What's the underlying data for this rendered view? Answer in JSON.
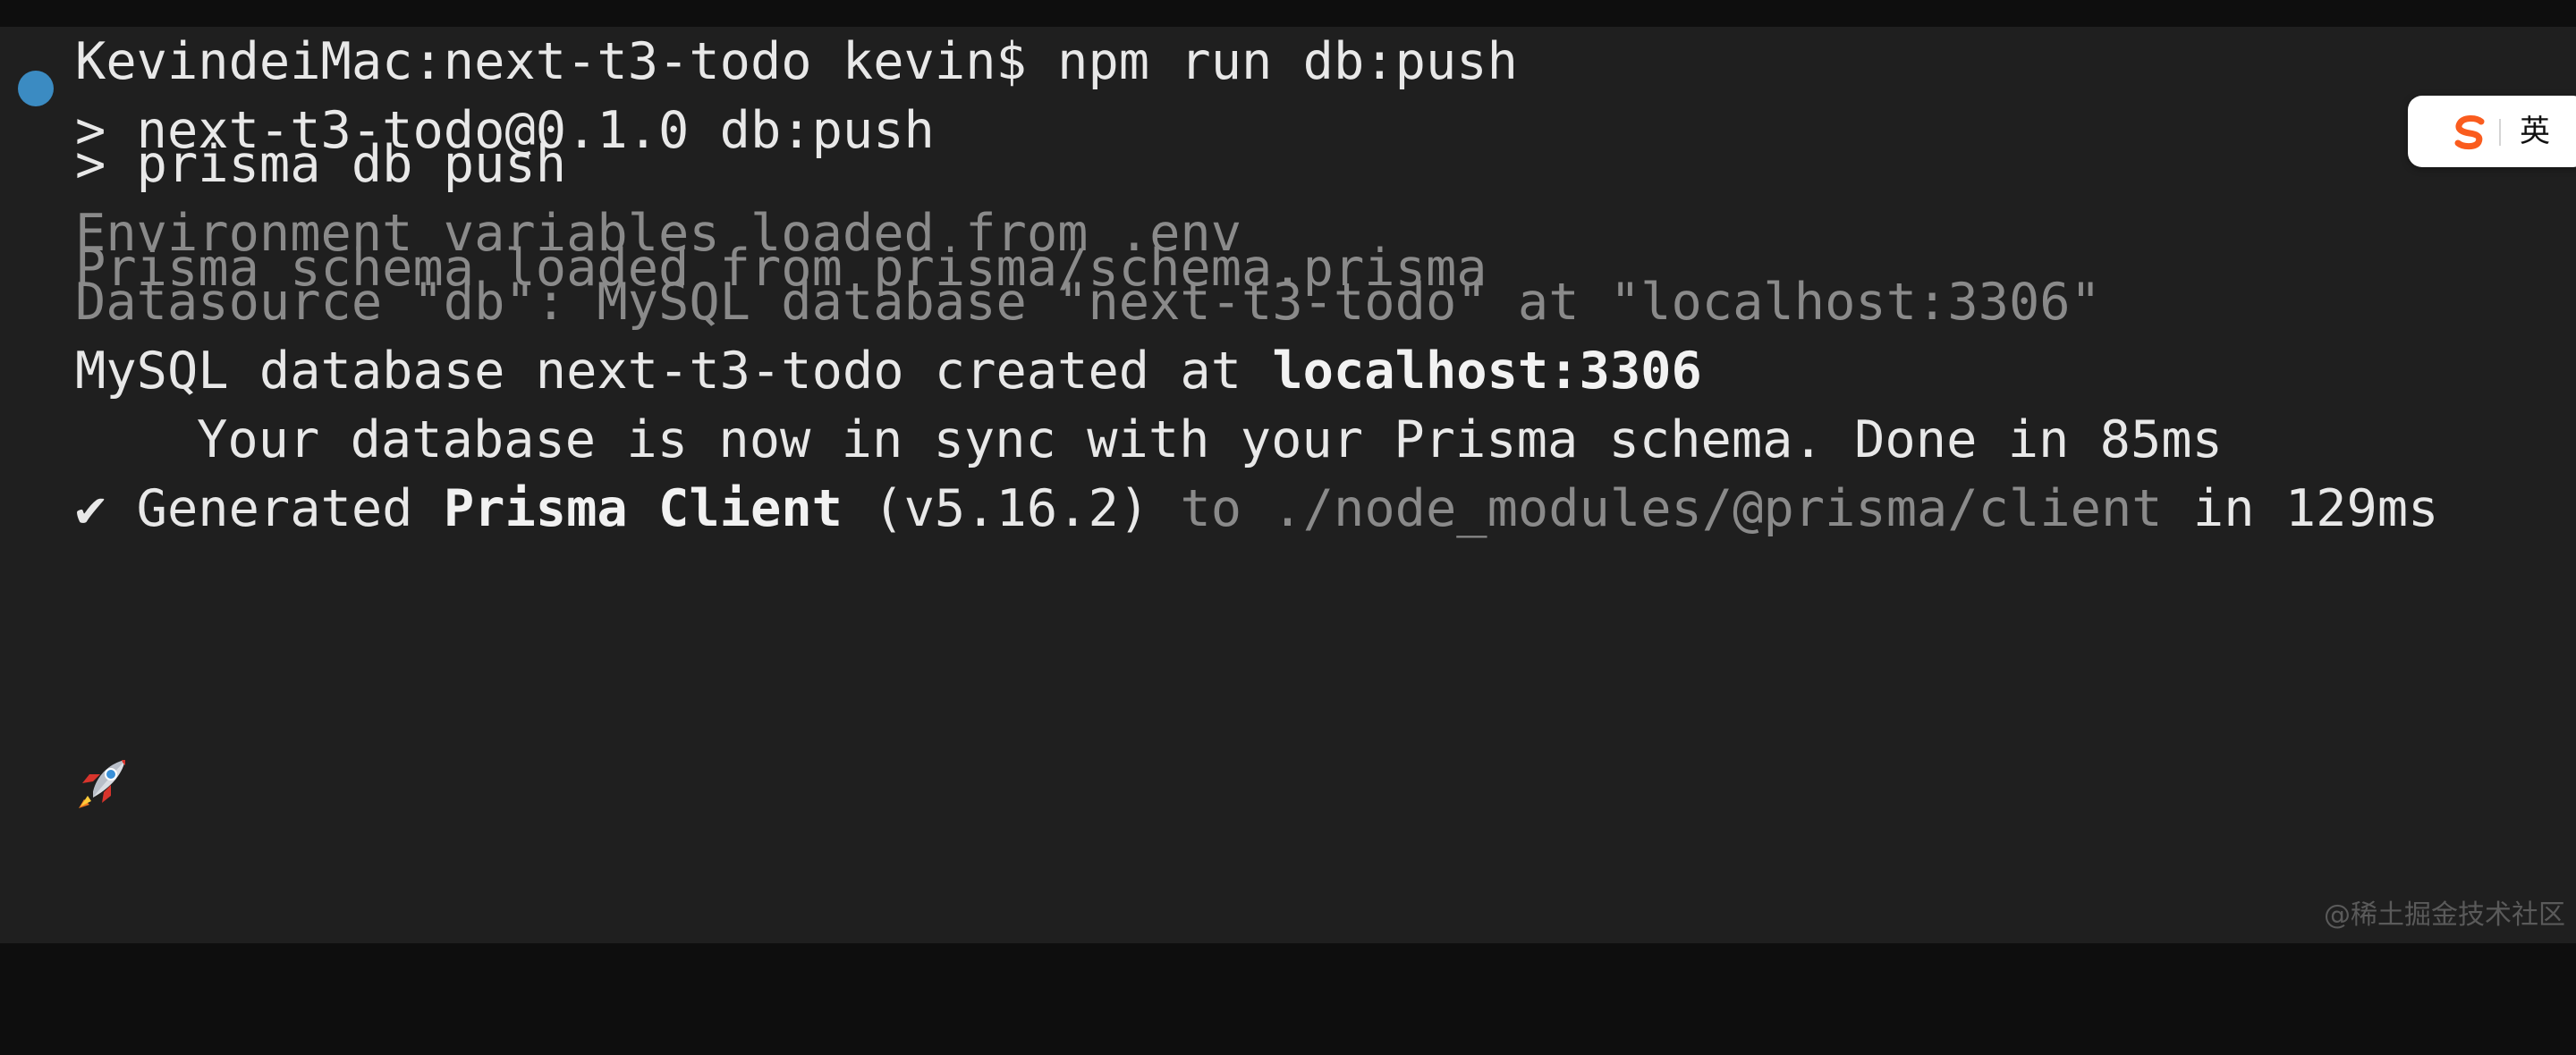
{
  "terminal": {
    "prompt": {
      "text": "KevindeiMac:next-t3-todo kevin$ npm run db:push",
      "status_color": "#3b8bc2"
    },
    "npm_header": {
      "line1": "> next-t3-todo@0.1.0 db:push",
      "line2": "> prisma db push"
    },
    "env_loaded": "Environment variables loaded from .env",
    "schema_loaded": "Prisma schema loaded from prisma/schema.prisma",
    "datasource": "Datasource \"db\": MySQL database \"next-t3-todo\" at \"localhost:3306\"",
    "created": {
      "prefix": "MySQL database next-t3-todo created at ",
      "host": "localhost:3306"
    },
    "sync": {
      "icon": "rocket-icon",
      "text": "Your database is now in sync with your Prisma schema. Done in 85ms"
    },
    "generated": {
      "check": "✔",
      "word": " Generated ",
      "client": "Prisma Client",
      "version": " (v5.16.2)",
      "to_path": " to ./node_modules/@prisma/client",
      "timing": " in 129ms"
    }
  },
  "ime": {
    "icon": "sogou-logo-icon",
    "language": "英"
  },
  "watermark": "@稀土掘金技术社区",
  "colors": {
    "terminal_bg": "#1f1f1f",
    "outer_bg": "#0e0e0e",
    "text": "#e8e8e8",
    "dim_text": "#8a8a8a",
    "ime_logo": "#fa5c1e"
  }
}
